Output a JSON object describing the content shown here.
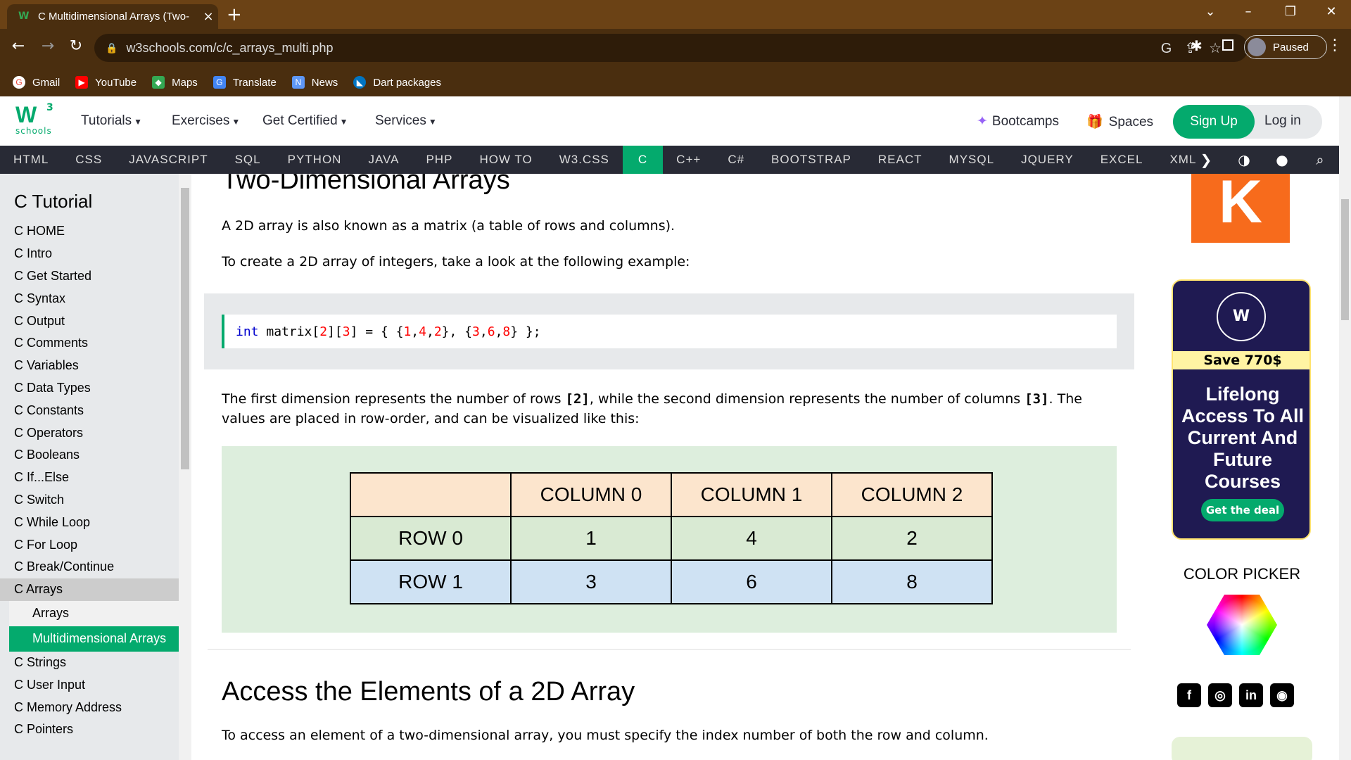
{
  "browser": {
    "tab_title": "C Multidimensional Arrays (Two-",
    "url": "w3schools.com/c/c_arrays_multi.php",
    "profile_status": "Paused",
    "bookmarks": [
      "Gmail",
      "YouTube",
      "Maps",
      "Translate",
      "News",
      "Dart packages"
    ]
  },
  "header": {
    "logo_sup": "3",
    "logo_text": "schools",
    "nav": [
      "Tutorials",
      "Exercises",
      "Get Certified",
      "Services"
    ],
    "bootcamps": "Bootcamps",
    "spaces": "Spaces",
    "signup": "Sign Up",
    "login": "Log in"
  },
  "langbar": [
    "HTML",
    "CSS",
    "JAVASCRIPT",
    "SQL",
    "PYTHON",
    "JAVA",
    "PHP",
    "HOW TO",
    "W3.CSS",
    "C",
    "C++",
    "C#",
    "BOOTSTRAP",
    "REACT",
    "MYSQL",
    "JQUERY",
    "EXCEL",
    "XML"
  ],
  "sidebar": {
    "title": "C Tutorial",
    "items": [
      "C HOME",
      "C Intro",
      "C Get Started",
      "C Syntax",
      "C Output",
      "C Comments",
      "C Variables",
      "C Data Types",
      "C Constants",
      "C Operators",
      "C Booleans",
      "C If...Else",
      "C Switch",
      "C While Loop",
      "C For Loop",
      "C Break/Continue",
      "C Arrays"
    ],
    "sub_items": [
      "Arrays",
      "Multidimensional Arrays"
    ],
    "items_after": [
      "C Strings",
      "C User Input",
      "C Memory Address",
      "C Pointers"
    ]
  },
  "main": {
    "heading1": "Two-Dimensional Arrays",
    "p1": "A 2D array is also known as a matrix (a table of rows and columns).",
    "p2": "To create a 2D array of integers, take a look at the following example:",
    "code_kw": "int",
    "code_name": " matrix[",
    "code_rest": "int matrix[2][3] = { {1, 4, 2}, {3, 6, 8} };",
    "p3a": "The first dimension represents the number of rows ",
    "p3b": "[2]",
    "p3c": ", while the second dimension represents the number of columns ",
    "p3d": "[3]",
    "p3e": ". The values are placed in row-order, and can be visualized like this:",
    "table": {
      "columns": [
        "COLUMN 0",
        "COLUMN 1",
        "COLUMN 2"
      ],
      "rows": [
        {
          "label": "ROW 0",
          "values": [
            "1",
            "4",
            "2"
          ]
        },
        {
          "label": "ROW 1",
          "values": [
            "3",
            "6",
            "8"
          ]
        }
      ]
    },
    "heading2": "Access the Elements of a 2D Array",
    "p4": "To access an element of a two-dimensional array, you must specify the index number of both the row and column."
  },
  "right": {
    "ad_letter": "K",
    "promo_save": "Save 770$",
    "promo_headline": "Lifelong Access To All Current And Future Courses",
    "promo_button": "Get the deal",
    "color_picker": "COLOR PICKER"
  },
  "colors": {
    "accent": "#04aa6d",
    "navbar": "#282a35",
    "chrome": "#4a2e0f"
  }
}
